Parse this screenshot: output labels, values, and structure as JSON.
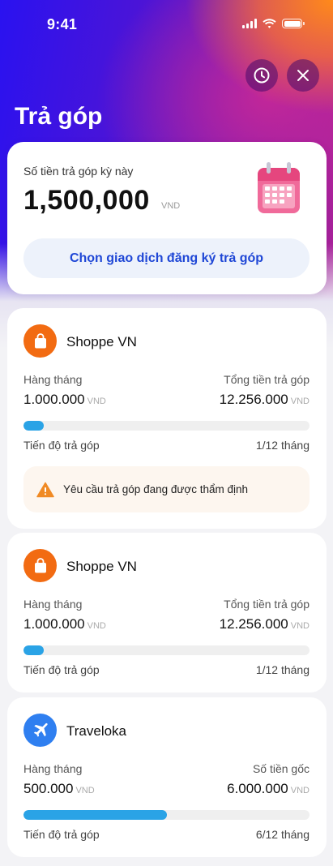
{
  "status_bar": {
    "time": "9:41"
  },
  "header": {
    "title": "Trả góp",
    "history_icon": "clock-icon",
    "close_icon": "close-icon"
  },
  "summary": {
    "label": "Số tiền trả góp kỳ này",
    "amount": "1,500,000",
    "currency": "VND",
    "icon": "calendar-icon",
    "button_label": "Chọn giao dịch đăng ký trả góp"
  },
  "plans": [
    {
      "merchant": "Shoppe VN",
      "icon": "shopping-bag-icon",
      "left_label": "Hàng tháng",
      "left_value": "1.000.000",
      "right_label": "Tổng tiền trả góp",
      "right_value": "12.256.000",
      "currency": "VND",
      "progress_label": "Tiến độ trả góp",
      "progress_text": "1/12 tháng",
      "progress": 0.07,
      "warning": "Yêu cầu trả góp đang được thẩm định"
    },
    {
      "merchant": "Shoppe VN",
      "icon": "shopping-bag-icon",
      "left_label": "Hàng tháng",
      "left_value": "1.000.000",
      "right_label": "Tổng tiền trả góp",
      "right_value": "12.256.000",
      "currency": "VND",
      "progress_label": "Tiến độ trả góp",
      "progress_text": "1/12 tháng",
      "progress": 0.07
    },
    {
      "merchant": "Traveloka",
      "icon": "airplane-icon",
      "left_label": "Hàng tháng",
      "left_value": "500.000",
      "right_label": "Số tiền gốc",
      "right_value": "6.000.000",
      "currency": "VND",
      "progress_label": "Tiến độ trả góp",
      "progress_text": "6/12 tháng",
      "progress": 0.5
    }
  ],
  "colors": {
    "accent": "#1f47d6",
    "progress": "#2aa3e6",
    "shop_icon_bg": "#f26b12",
    "travel_icon_bg": "#2f7ff0",
    "warning": "#f08a24"
  }
}
